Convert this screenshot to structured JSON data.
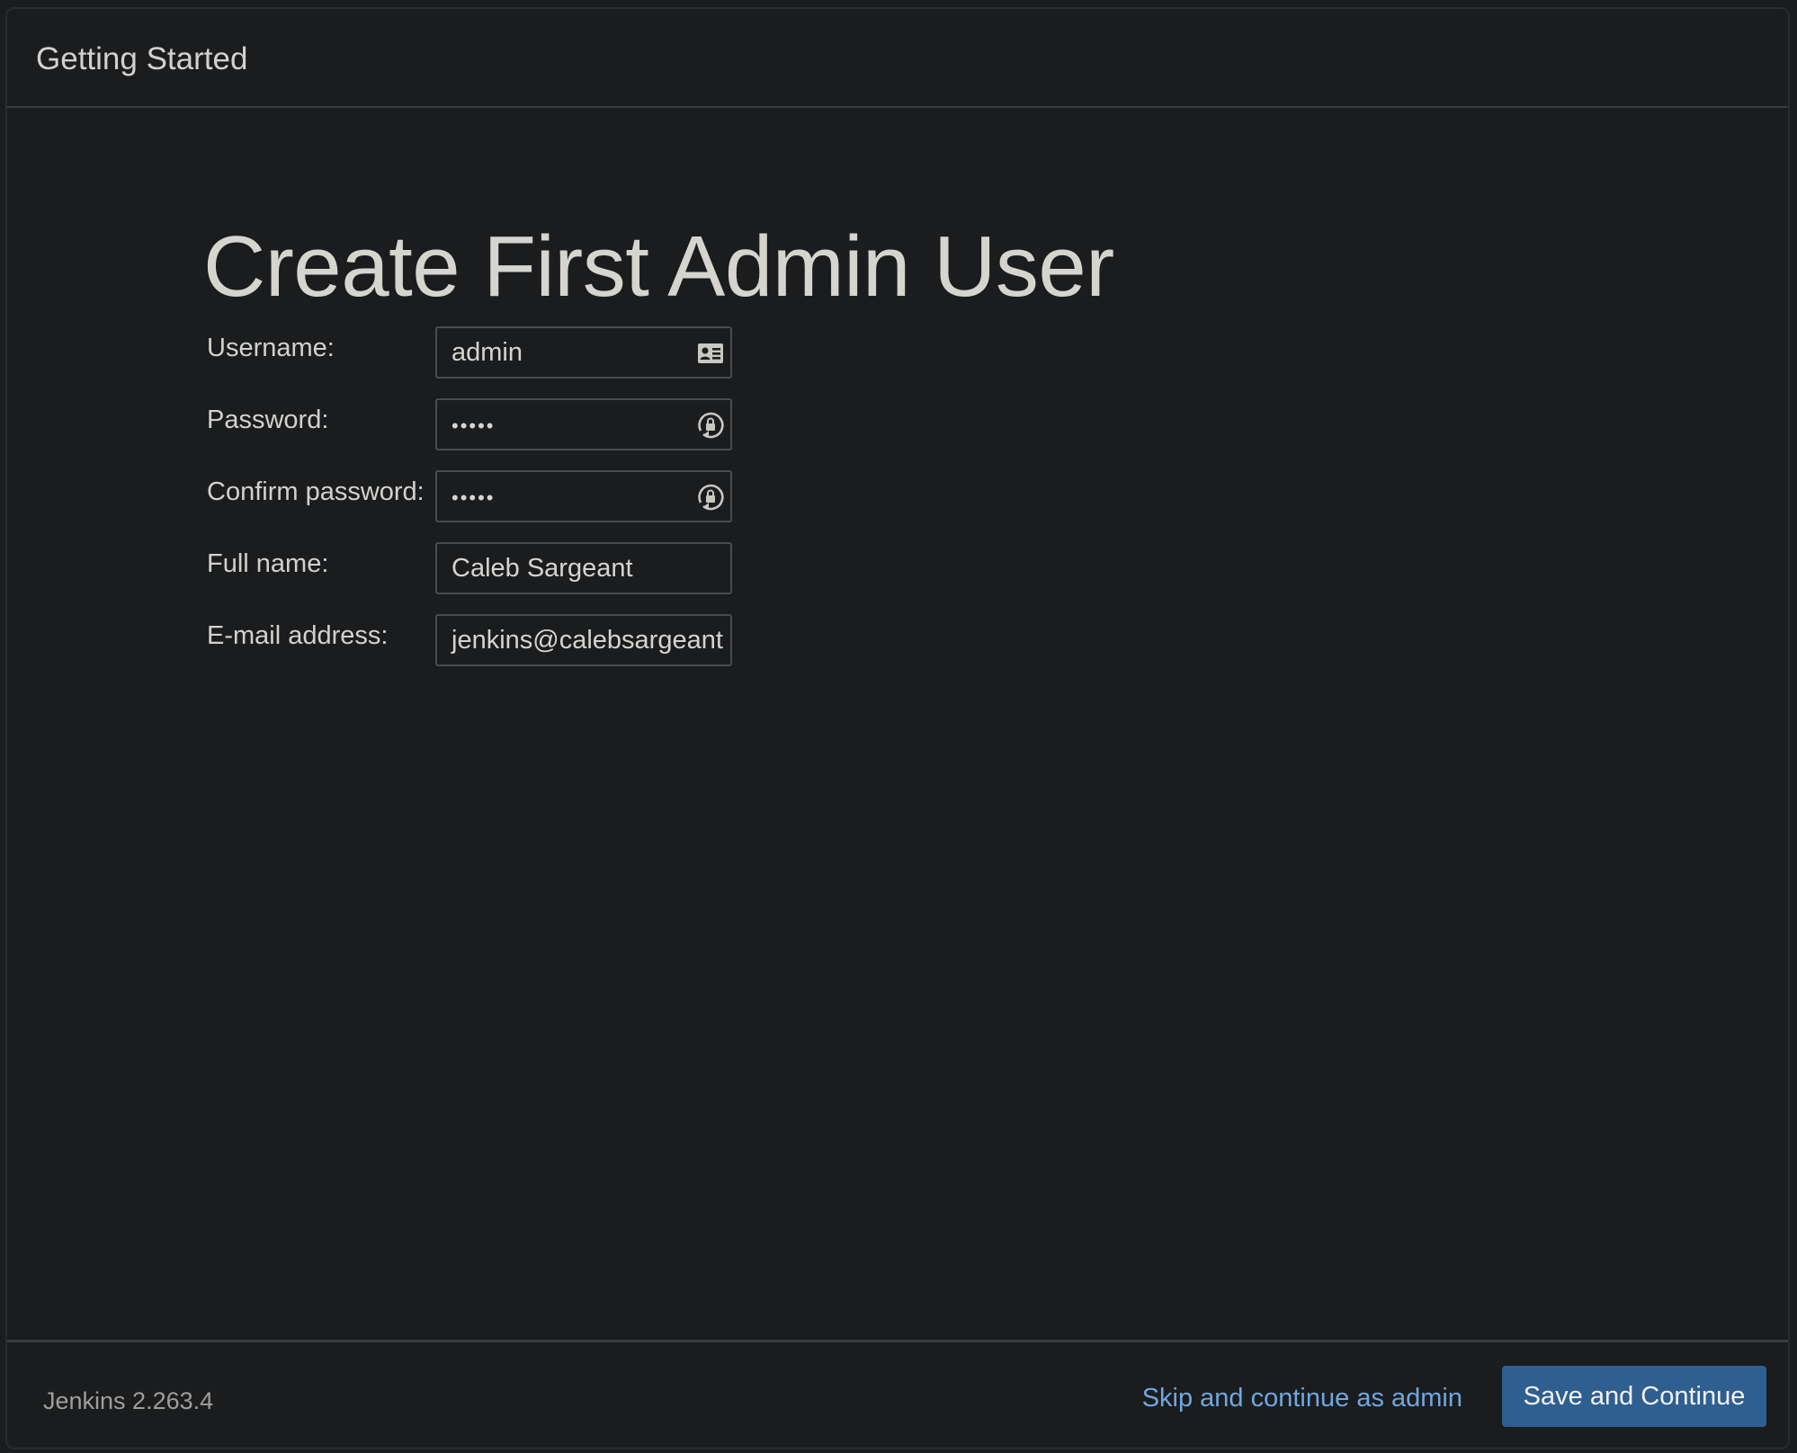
{
  "header": {
    "title": "Getting Started"
  },
  "main": {
    "page_title": "Create First Admin User",
    "fields": {
      "username": {
        "label": "Username:",
        "value": "admin",
        "icon": "contact-card-icon"
      },
      "password": {
        "label": "Password:",
        "value": "•••••",
        "icon": "password-manager-icon"
      },
      "confirm_password": {
        "label": "Confirm password:",
        "value": "•••••",
        "icon": "password-manager-icon"
      },
      "full_name": {
        "label": "Full name:",
        "value": "Caleb Sargeant"
      },
      "email": {
        "label": "E-mail address:",
        "value": "jenkins@calebsargeant"
      }
    }
  },
  "footer": {
    "version": "Jenkins 2.263.4",
    "skip_label": "Skip and continue as admin",
    "save_label": "Save and Continue"
  },
  "colors": {
    "background": "#1b1c1e",
    "link": "#6ea8e0",
    "primary_button": "#2f5f90"
  }
}
